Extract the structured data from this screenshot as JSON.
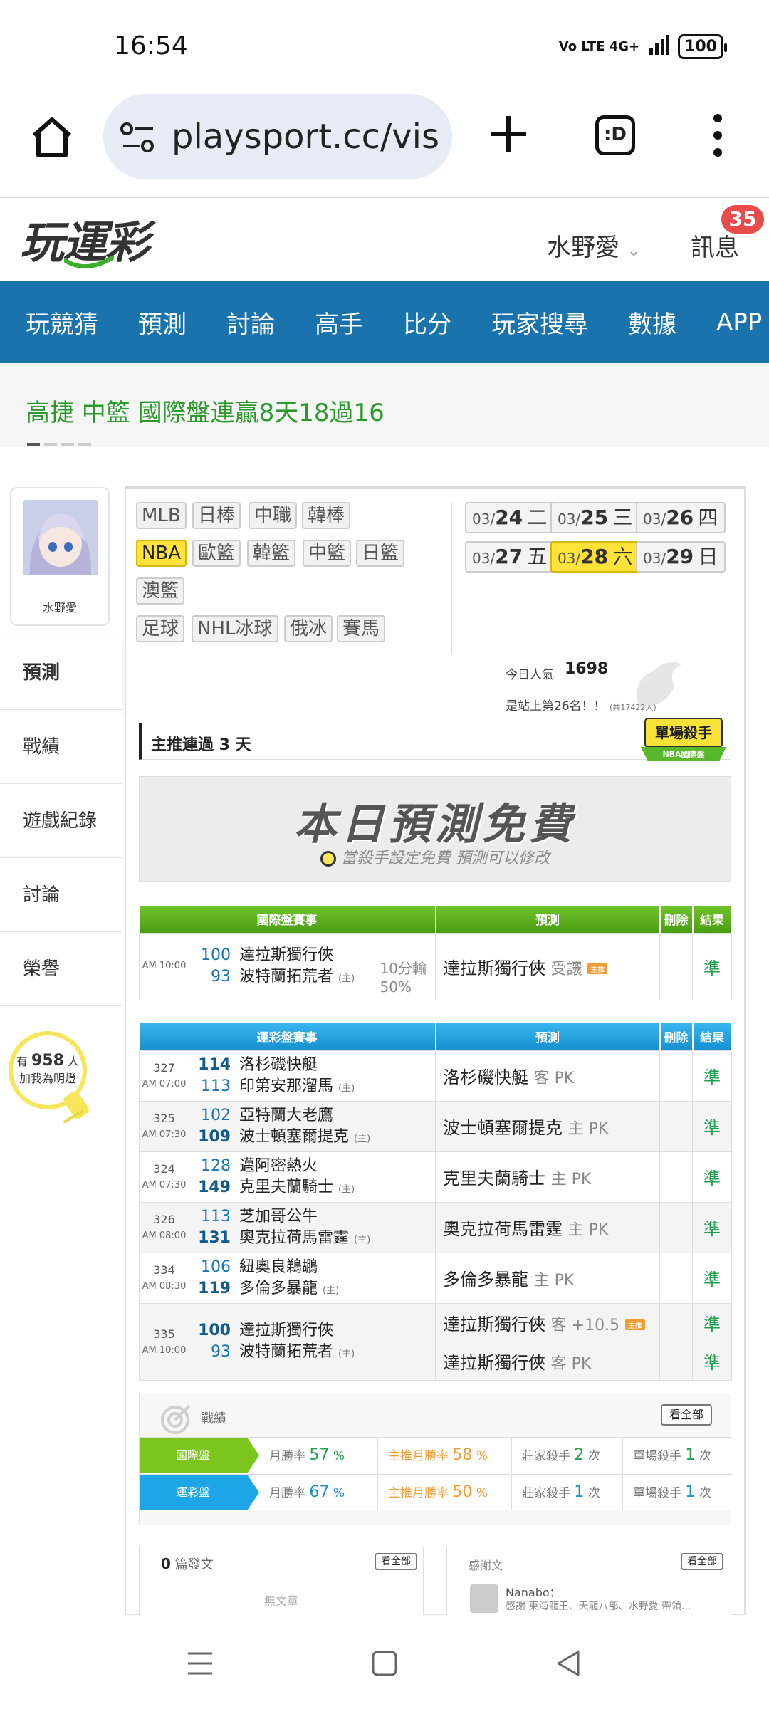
{
  "status_bar": {
    "time": "16:54",
    "network": "Vo LTE 4G+",
    "battery": "100"
  },
  "browser": {
    "url": "playsport.cc/visit",
    "tabs_label": ":D"
  },
  "site": {
    "logo": "玩運彩",
    "username": "水野愛",
    "messages_label": "訊息",
    "messages_badge": "35"
  },
  "nav": {
    "items": [
      "玩競猜",
      "預測",
      "討論",
      "高手",
      "比分",
      "玩家搜尋",
      "數據",
      "APP"
    ]
  },
  "promo": {
    "text": "高捷 中籃 國際盤連贏8天18過16"
  },
  "profile": {
    "name": "水野愛",
    "menu": [
      "預測",
      "戰績",
      "遊戲紀錄",
      "討論",
      "榮譽"
    ],
    "fans_prefix": "有",
    "fans_count": "958",
    "fans_suffix": "人",
    "fans_line2": "加我為明燈"
  },
  "sports": {
    "row1": [
      "MLB",
      "日棒",
      "中職",
      "韓棒"
    ],
    "row2": [
      "NBA",
      "歐籃",
      "韓籃",
      "中籃",
      "日籃"
    ],
    "row3": [
      "澳籃"
    ],
    "row4": [
      "足球",
      "NHL冰球",
      "俄冰",
      "賽馬"
    ],
    "selected": "NBA"
  },
  "dates": [
    {
      "md": "03/",
      "d": "24",
      "w": "二"
    },
    {
      "md": "03/",
      "d": "25",
      "w": "三"
    },
    {
      "md": "03/",
      "d": "26",
      "w": "四"
    },
    {
      "md": "03/",
      "d": "27",
      "w": "五"
    },
    {
      "md": "03/",
      "d": "28",
      "w": "六",
      "selected": true
    },
    {
      "md": "03/",
      "d": "29",
      "w": "日"
    }
  ],
  "stats": {
    "pop_label": "今日人氣",
    "pop_value": "1698",
    "rank_text": "是站上第26名！！",
    "rank_small": "(共17422人)"
  },
  "streak": {
    "text": "主推連過 3 天",
    "badge_title": "單場殺手",
    "badge_sub": "NBA國際盤"
  },
  "free_banner": {
    "title": "本日預測免費",
    "subtitle": "當殺手設定免費 預測可以修改"
  },
  "intl_table": {
    "headers": [
      "國際盤賽事",
      "預測",
      "刪除",
      "結果"
    ],
    "rows": [
      {
        "time": "AM 10:00",
        "s1": "100",
        "t1": "達拉斯獨行俠",
        "s2": "93",
        "t2": "波特蘭拓荒者",
        "home": "(主)",
        "extra1": "10分輸",
        "extra2": "50%",
        "pred": "達拉斯獨行俠",
        "pred_type": "受讓",
        "tag": "主推",
        "result": "準"
      }
    ]
  },
  "lottery_table": {
    "headers": [
      "運彩盤賽事",
      "預測",
      "刪除",
      "結果"
    ],
    "rows": [
      {
        "num": "327",
        "time": "AM 07:00",
        "s1": "114",
        "t1": "洛杉磯快艇",
        "s2": "113",
        "t2": "印第安那溜馬",
        "home": "(主)",
        "pred": "洛杉磯快艇",
        "pred_type": "客 PK",
        "result": "準",
        "b1": true
      },
      {
        "num": "325",
        "time": "AM 07:30",
        "s1": "102",
        "t1": "亞特蘭大老鷹",
        "s2": "109",
        "t2": "波士頓塞爾提克",
        "home": "(主)",
        "pred": "波士頓塞爾提克",
        "pred_type": "主 PK",
        "result": "準",
        "b2": true
      },
      {
        "num": "324",
        "time": "AM 07:30",
        "s1": "128",
        "t1": "邁阿密熱火",
        "s2": "149",
        "t2": "克里夫蘭騎士",
        "home": "(主)",
        "pred": "克里夫蘭騎士",
        "pred_type": "主 PK",
        "result": "準",
        "b2": true
      },
      {
        "num": "326",
        "time": "AM 08:00",
        "s1": "113",
        "t1": "芝加哥公牛",
        "s2": "131",
        "t2": "奧克拉荷馬雷霆",
        "home": "(主)",
        "pred": "奧克拉荷馬雷霆",
        "pred_type": "主 PK",
        "result": "準",
        "b2": true
      },
      {
        "num": "334",
        "time": "AM 08:30",
        "s1": "106",
        "t1": "紐奧良鵜鶘",
        "s2": "119",
        "t2": "多倫多暴龍",
        "home": "(主)",
        "pred": "多倫多暴龍",
        "pred_type": "主 PK",
        "result": "準",
        "b2": true
      }
    ],
    "last": {
      "num": "335",
      "time": "AM 10:00",
      "s1": "100",
      "t1": "達拉斯獨行俠",
      "s2": "93",
      "t2": "波特蘭拓荒者",
      "home": "(主)",
      "pred1": "達拉斯獨行俠",
      "pred1_type": "客 +10.5",
      "tag": "主推",
      "result1": "準",
      "pred2": "達拉斯獨行俠",
      "pred2_type": "客 PK",
      "result2": "準"
    }
  },
  "record": {
    "title": "戰績",
    "all_label": "看全部",
    "rows": [
      {
        "label": "國際盤",
        "color": "#7cc51d",
        "month_rate_label": "月勝率",
        "month_rate": "57",
        "main_rate_label": "主推月勝率",
        "main_rate": "58",
        "banker_label": "莊家殺手",
        "banker": "2",
        "single_label": "單場殺手",
        "single": "1",
        "unit_pct": "%",
        "unit_times": "次"
      },
      {
        "label": "運彩盤",
        "color": "#1ea5e8",
        "month_rate_label": "月勝率",
        "month_rate": "67",
        "main_rate_label": "主推月勝率",
        "main_rate": "50",
        "banker_label": "莊家殺手",
        "banker": "1",
        "single_label": "單場殺手",
        "single": "1",
        "unit_pct": "%",
        "unit_times": "次"
      }
    ]
  },
  "posts": {
    "count": "0",
    "label": "篇發文",
    "all_label": "看全部",
    "empty": "無文章"
  },
  "thanks": {
    "label": "感謝文",
    "all_label": "看全部",
    "user": "Nanabo：",
    "text": "感謝 東海龍王、天龍八部、水野愛 帶領..."
  }
}
